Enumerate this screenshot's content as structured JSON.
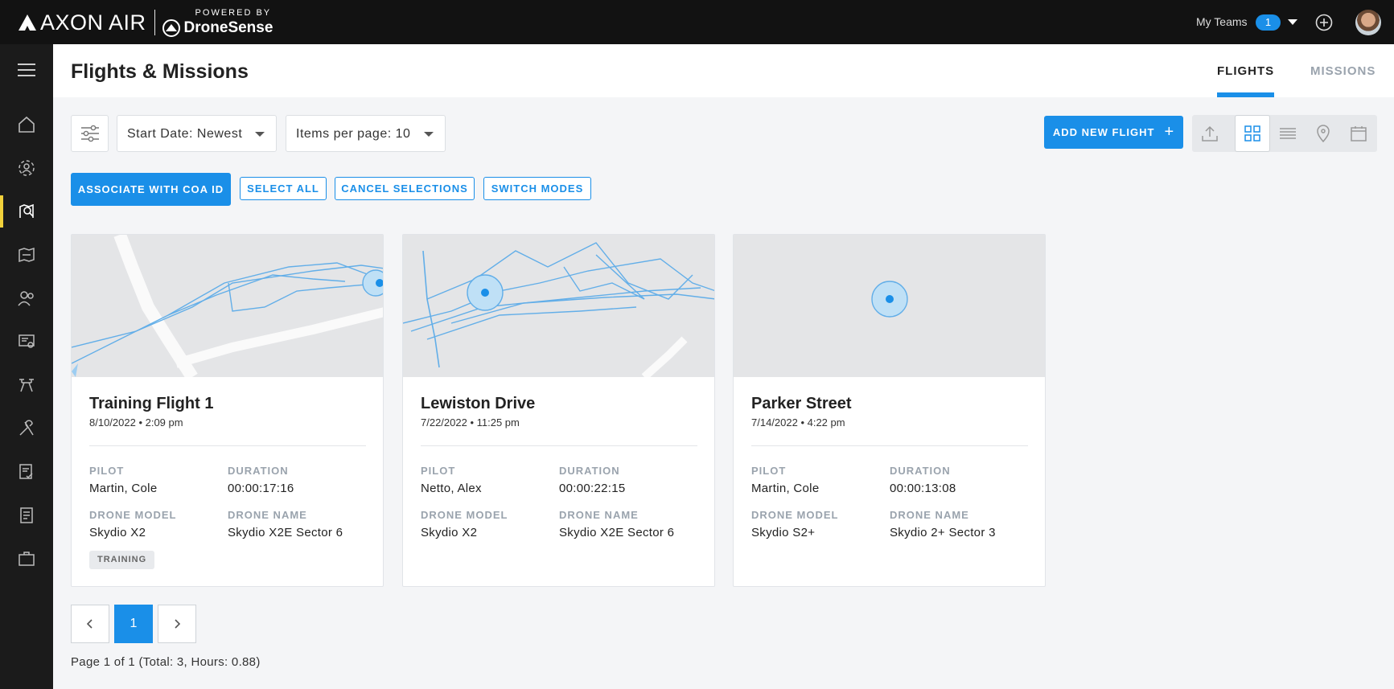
{
  "brand": {
    "name": "AXON AIR",
    "powered_by": "POWERED BY",
    "partner": "DroneSense"
  },
  "topbar": {
    "teams_label": "My Teams",
    "teams_count": "1"
  },
  "header": {
    "title": "Flights & Missions",
    "tabs": [
      {
        "label": "FLIGHTS",
        "active": true
      },
      {
        "label": "MISSIONS",
        "active": false
      }
    ]
  },
  "toolbar": {
    "sort_label": "Start Date: Newest",
    "items_label": "Items per page: 10",
    "add_label": "ADD NEW FLIGHT",
    "add_icon": "+"
  },
  "actions": {
    "associate": "ASSOCIATE WITH COA ID",
    "select_all": "SELECT ALL",
    "cancel": "CANCEL SELECTIONS",
    "switch": "SWITCH MODES"
  },
  "labels": {
    "pilot": "PILOT",
    "duration": "DURATION",
    "drone_model": "DRONE MODEL",
    "drone_name": "DRONE NAME"
  },
  "flights": [
    {
      "title": "Training Flight 1",
      "date": "8/10/2022 • 2:09 pm",
      "pilot": "Martin, Cole",
      "duration": "00:00:17:16",
      "drone_model": "Skydio X2",
      "drone_name": "Skydio X2E Sector 6",
      "tag": "TRAINING"
    },
    {
      "title": "Lewiston Drive",
      "date": "7/22/2022 • 11:25 pm",
      "pilot": "Netto, Alex",
      "duration": "00:00:22:15",
      "drone_model": "Skydio X2",
      "drone_name": "Skydio X2E Sector 6"
    },
    {
      "title": "Parker Street",
      "date": "7/14/2022 • 4:22 pm",
      "pilot": "Martin, Cole",
      "duration": "00:00:13:08",
      "drone_model": "Skydio S2+",
      "drone_name": "Skydio 2+ Sector 3"
    }
  ],
  "pagination": {
    "current": "1",
    "info": "Page 1 of 1  (Total: 3, Hours: 0.88)"
  },
  "colors": {
    "accent": "#1a8fe8",
    "topbar": "#121212",
    "sidebar": "#1b1b1b",
    "active_indicator": "#f2d13b"
  }
}
